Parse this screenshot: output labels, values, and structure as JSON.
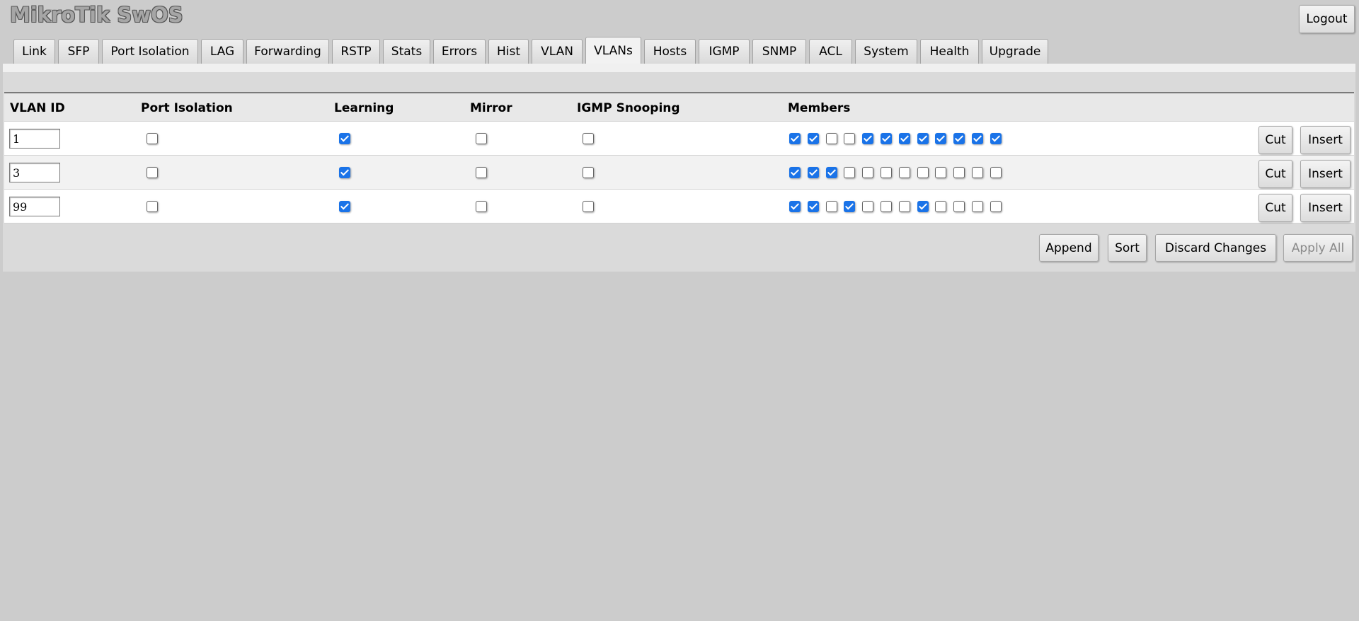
{
  "app": {
    "title": "MikroTik SwOS",
    "logout_label": "Logout"
  },
  "tabs": [
    {
      "label": "Link"
    },
    {
      "label": "SFP"
    },
    {
      "label": "Port Isolation"
    },
    {
      "label": "LAG"
    },
    {
      "label": "Forwarding"
    },
    {
      "label": "RSTP"
    },
    {
      "label": "Stats"
    },
    {
      "label": "Errors"
    },
    {
      "label": "Hist"
    },
    {
      "label": "VLAN"
    },
    {
      "label": "VLANs",
      "active": true
    },
    {
      "label": "Hosts"
    },
    {
      "label": "IGMP"
    },
    {
      "label": "SNMP"
    },
    {
      "label": "ACL"
    },
    {
      "label": "System"
    },
    {
      "label": "Health"
    },
    {
      "label": "Upgrade"
    }
  ],
  "table": {
    "headers": {
      "vlan_id": "VLAN ID",
      "port_isolation": "Port Isolation",
      "learning": "Learning",
      "mirror": "Mirror",
      "igmp_snooping": "IGMP Snooping",
      "members": "Members"
    },
    "rows": [
      {
        "vlan_id": "1",
        "port_isolation": false,
        "learning": true,
        "mirror": false,
        "igmp_snooping": false,
        "members": [
          true,
          true,
          false,
          false,
          true,
          true,
          true,
          true,
          true,
          true,
          true,
          true
        ]
      },
      {
        "vlan_id": "3",
        "port_isolation": false,
        "learning": true,
        "mirror": false,
        "igmp_snooping": false,
        "members": [
          true,
          true,
          true,
          false,
          false,
          false,
          false,
          false,
          false,
          false,
          false,
          false
        ]
      },
      {
        "vlan_id": "99",
        "port_isolation": false,
        "learning": true,
        "mirror": false,
        "igmp_snooping": false,
        "members": [
          true,
          true,
          false,
          true,
          false,
          false,
          false,
          true,
          false,
          false,
          false,
          false
        ]
      }
    ],
    "row_buttons": {
      "cut_label": "Cut",
      "insert_label": "Insert"
    }
  },
  "actions": {
    "append_label": "Append",
    "sort_label": "Sort",
    "discard_label": "Discard Changes",
    "apply_label": "Apply All",
    "apply_disabled": true
  },
  "colors": {
    "background": "#cccccc",
    "checkbox_checked": "#1a73e8"
  }
}
